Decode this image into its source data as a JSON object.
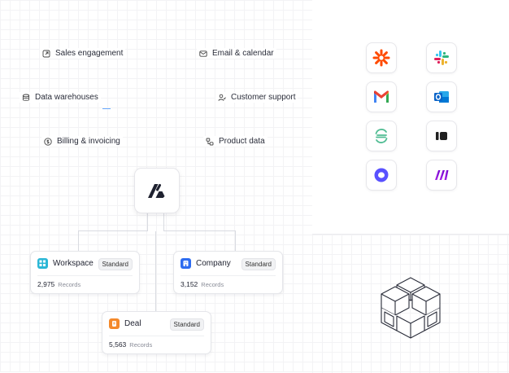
{
  "categories": [
    {
      "label": "Sales engagement",
      "icon": "external-link-icon"
    },
    {
      "label": "Email & calendar",
      "icon": "mail-icon"
    },
    {
      "label": "Data warehouses",
      "icon": "database-icon"
    },
    {
      "label": "Customer support",
      "icon": "user-support-icon"
    },
    {
      "label": "Billing & invoicing",
      "icon": "dollar-circle-icon"
    },
    {
      "label": "Product data",
      "icon": "product-data-icon"
    }
  ],
  "objects": [
    {
      "name": "Workspace",
      "badge": "Standard",
      "count": "2,975",
      "count_label": "Records",
      "color": "#2bb7d6",
      "icon": "workspace-icon"
    },
    {
      "name": "Company",
      "badge": "Standard",
      "count": "3,152",
      "count_label": "Records",
      "color": "#2d6cf0",
      "icon": "company-icon"
    },
    {
      "name": "Deal",
      "badge": "Standard",
      "count": "5,563",
      "count_label": "Records",
      "color": "#f4892b",
      "icon": "deal-icon"
    }
  ],
  "apps": [
    {
      "name": "Zapier",
      "icon": "zapier-icon",
      "color": "#ff4a00"
    },
    {
      "name": "Slack",
      "icon": "slack-icon",
      "color": "#4a154b"
    },
    {
      "name": "Gmail",
      "icon": "gmail-icon",
      "color": "#ea4335"
    },
    {
      "name": "Outlook",
      "icon": "outlook-icon",
      "color": "#0a64c8"
    },
    {
      "name": "Segment",
      "icon": "segment-icon",
      "color": "#52bd94"
    },
    {
      "name": "Intercom",
      "icon": "intercom-icon",
      "color": "#1f1f1f"
    },
    {
      "name": "Outreach",
      "icon": "outreach-icon",
      "color": "#5951ff"
    },
    {
      "name": "Make",
      "icon": "make-icon",
      "color": "#6d00cc"
    }
  ]
}
